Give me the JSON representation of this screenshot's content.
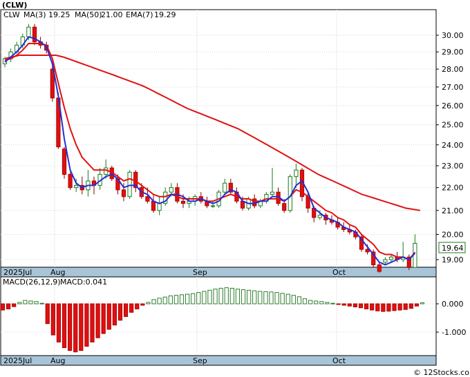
{
  "title": "(CLW)",
  "legend": {
    "ticker": "CLW",
    "ma3_label": "MA(3)",
    "ma3_value": "19.25",
    "ma50_label": "MA(50)",
    "ma50_value": "21.00",
    "ema7_label": "EMA(7)",
    "ema7_value": "19.29"
  },
  "last_price_badge": "19.64",
  "macd_legend": {
    "label": "MACD(26,12,9)",
    "value_label": "MACD:0.041"
  },
  "x_tick_labels_price": [
    "2025Jul",
    "Aug",
    "Sep",
    "Oct"
  ],
  "x_tick_labels_macd": [
    "2025Jul",
    "Aug",
    "Sep",
    "Oct"
  ],
  "watermark": "© 12Stocks.com",
  "colors": {
    "up": "#1a7a1a",
    "down": "#e01010",
    "ma3": "#1f2fd6",
    "ema7": "#e01010",
    "ma50": "#e01010",
    "macd_pos": "#2e7d2e",
    "macd_neg": "#e01010",
    "axis_band": "#a8c4d8"
  },
  "chart_data": [
    {
      "type": "candlestick",
      "title": "(CLW)",
      "ylim": [
        18.5,
        31.0
      ],
      "y_scale": "log",
      "y_ticks": [
        "19.00",
        "20.00",
        "21.00",
        "22.00",
        "23.00",
        "24.00",
        "25.00",
        "26.00",
        "27.00",
        "28.00",
        "29.00",
        "30.00"
      ],
      "x_labels": [
        "2025Jul",
        "Aug",
        "Sep",
        "Oct"
      ],
      "candles": [
        [
          28.3,
          28.7,
          28.1,
          28.6
        ],
        [
          28.6,
          29.2,
          28.4,
          29.0
        ],
        [
          29.0,
          29.6,
          28.9,
          29.4
        ],
        [
          29.4,
          30.1,
          29.2,
          29.9
        ],
        [
          29.9,
          30.7,
          29.7,
          30.5
        ],
        [
          30.5,
          30.7,
          29.4,
          29.6
        ],
        [
          29.6,
          29.9,
          29.2,
          29.4
        ],
        [
          29.4,
          29.6,
          28.9,
          29.1
        ],
        [
          28.0,
          28.2,
          26.2,
          26.4
        ],
        [
          26.4,
          26.7,
          23.8,
          23.9
        ],
        [
          23.8,
          23.9,
          22.4,
          22.6
        ],
        [
          22.6,
          22.7,
          21.9,
          22.0
        ],
        [
          22.0,
          22.4,
          21.8,
          22.1
        ],
        [
          22.1,
          22.5,
          21.7,
          21.9
        ],
        [
          21.9,
          22.8,
          21.6,
          22.3
        ],
        [
          22.3,
          22.5,
          21.7,
          22.1
        ],
        [
          22.1,
          22.9,
          21.9,
          22.6
        ],
        [
          22.6,
          23.3,
          22.4,
          22.9
        ],
        [
          22.9,
          23.0,
          22.3,
          22.4
        ],
        [
          22.4,
          22.6,
          21.7,
          21.9
        ],
        [
          21.9,
          22.2,
          21.4,
          21.6
        ],
        [
          21.6,
          22.8,
          21.5,
          22.7
        ],
        [
          22.7,
          22.8,
          21.8,
          22.0
        ],
        [
          22.0,
          22.2,
          21.5,
          21.6
        ],
        [
          21.6,
          22.0,
          21.3,
          21.4
        ],
        [
          21.4,
          21.7,
          20.9,
          21.0
        ],
        [
          21.0,
          21.6,
          20.8,
          21.3
        ],
        [
          21.3,
          22.0,
          21.2,
          21.8
        ],
        [
          21.8,
          22.2,
          21.6,
          22.0
        ],
        [
          22.0,
          22.2,
          21.3,
          21.4
        ],
        [
          21.4,
          21.7,
          21.1,
          21.3
        ],
        [
          21.3,
          21.6,
          21.1,
          21.4
        ],
        [
          21.4,
          21.7,
          21.2,
          21.6
        ],
        [
          21.6,
          21.8,
          21.3,
          21.4
        ],
        [
          21.4,
          21.6,
          21.1,
          21.2
        ],
        [
          21.2,
          21.4,
          21.1,
          21.2
        ],
        [
          21.2,
          21.9,
          21.1,
          21.8
        ],
        [
          21.8,
          22.4,
          21.7,
          22.2
        ],
        [
          22.2,
          22.4,
          21.7,
          21.8
        ],
        [
          21.8,
          22.0,
          21.3,
          21.4
        ],
        [
          21.4,
          21.6,
          21.0,
          21.1
        ],
        [
          21.1,
          21.6,
          21.0,
          21.5
        ],
        [
          21.5,
          21.7,
          21.1,
          21.2
        ],
        [
          21.2,
          21.5,
          21.1,
          21.4
        ],
        [
          21.4,
          21.8,
          21.3,
          21.7
        ],
        [
          21.7,
          22.9,
          21.6,
          21.8
        ],
        [
          21.8,
          22.0,
          21.2,
          21.3
        ],
        [
          21.3,
          21.5,
          20.9,
          21.0
        ],
        [
          21.0,
          22.6,
          20.9,
          22.5
        ],
        [
          22.5,
          23.1,
          22.0,
          22.8
        ],
        [
          22.8,
          22.9,
          21.4,
          21.6
        ],
        [
          21.6,
          21.8,
          20.9,
          21.1
        ],
        [
          21.1,
          21.2,
          20.5,
          20.7
        ],
        [
          20.7,
          21.0,
          20.6,
          20.8
        ],
        [
          20.8,
          20.9,
          20.4,
          20.6
        ],
        [
          20.6,
          20.8,
          20.4,
          20.5
        ],
        [
          20.5,
          20.7,
          20.2,
          20.3
        ],
        [
          20.3,
          20.5,
          20.1,
          20.2
        ],
        [
          20.2,
          20.4,
          20.0,
          20.1
        ],
        [
          20.1,
          20.2,
          19.8,
          19.9
        ],
        [
          19.9,
          20.0,
          19.3,
          19.4
        ],
        [
          19.4,
          19.6,
          19.2,
          19.3
        ],
        [
          19.3,
          19.4,
          18.7,
          18.8
        ],
        [
          18.8,
          18.9,
          18.5,
          18.55
        ],
        [
          18.9,
          19.1,
          18.8,
          19.0
        ],
        [
          19.0,
          19.2,
          18.9,
          19.1
        ],
        [
          19.1,
          19.3,
          18.9,
          19.0
        ],
        [
          19.0,
          19.7,
          18.9,
          19.1
        ],
        [
          19.1,
          19.2,
          18.6,
          18.7
        ],
        [
          18.7,
          20.0,
          18.8,
          19.64
        ]
      ],
      "ma3": [
        28.4,
        28.7,
        29.0,
        29.4,
        29.9,
        29.8,
        29.6,
        29.3,
        28.3,
        26.5,
        24.3,
        22.8,
        22.2,
        22.0,
        22.1,
        22.1,
        22.3,
        22.5,
        22.6,
        22.4,
        22.0,
        22.1,
        22.1,
        21.8,
        21.7,
        21.4,
        21.3,
        21.4,
        21.7,
        21.7,
        21.6,
        21.4,
        21.4,
        21.5,
        21.4,
        21.3,
        21.4,
        21.7,
        21.9,
        21.8,
        21.4,
        21.3,
        21.3,
        21.4,
        21.4,
        21.6,
        21.6,
        21.4,
        21.6,
        22.1,
        22.3,
        21.8,
        21.1,
        20.9,
        20.7,
        20.6,
        20.5,
        20.3,
        20.2,
        20.1,
        19.8,
        19.5,
        19.2,
        18.9,
        18.8,
        18.9,
        19.0,
        19.1,
        19.0,
        19.25
      ],
      "ema7": [
        28.5,
        28.6,
        28.8,
        29.1,
        29.5,
        29.5,
        29.5,
        29.4,
        28.6,
        27.2,
        25.9,
        24.8,
        24.0,
        23.4,
        23.1,
        22.8,
        22.8,
        22.8,
        22.7,
        22.5,
        22.3,
        22.4,
        22.3,
        22.1,
        21.9,
        21.7,
        21.6,
        21.6,
        21.7,
        21.6,
        21.5,
        21.5,
        21.5,
        21.5,
        21.4,
        21.4,
        21.5,
        21.6,
        21.7,
        21.6,
        21.5,
        21.5,
        21.4,
        21.4,
        21.5,
        21.5,
        21.5,
        21.4,
        21.6,
        21.9,
        21.8,
        21.6,
        21.4,
        21.2,
        21.0,
        20.9,
        20.7,
        20.6,
        20.4,
        20.3,
        20.0,
        19.8,
        19.6,
        19.3,
        19.2,
        19.2,
        19.1,
        19.1,
        19.0,
        19.29
      ],
      "ma50": [
        28.6,
        28.7,
        28.8,
        28.8,
        28.8,
        28.8,
        28.8,
        28.8,
        28.7,
        28.55,
        28.4,
        28.25,
        28.1,
        27.95,
        27.8,
        27.65,
        27.5,
        27.35,
        27.2,
        27.05,
        26.85,
        26.65,
        26.45,
        26.25,
        26.05,
        25.85,
        25.7,
        25.55,
        25.4,
        25.25,
        25.1,
        24.95,
        24.8,
        24.6,
        24.4,
        24.2,
        24.0,
        23.8,
        23.6,
        23.4,
        23.2,
        23.0,
        22.8,
        22.6,
        22.45,
        22.3,
        22.15,
        22.0,
        21.85,
        21.7,
        21.6,
        21.5,
        21.4,
        21.3,
        21.2,
        21.1,
        21.05,
        21.0
      ],
      "last_price": 19.64
    },
    {
      "type": "bar",
      "title": "MACD(26,12,9)",
      "ylim": [
        -1.8,
        0.85
      ],
      "y_ticks": [
        "0.000",
        "-1.000"
      ],
      "x_labels": [
        "2025Jul",
        "Aug",
        "Sep",
        "Oct"
      ],
      "values": [
        -0.22,
        -0.18,
        -0.1,
        0.05,
        0.12,
        0.1,
        0.08,
        0.02,
        -0.7,
        -1.1,
        -1.35,
        -1.55,
        -1.65,
        -1.7,
        -1.65,
        -1.5,
        -1.35,
        -1.2,
        -1.05,
        -0.9,
        -0.75,
        -0.58,
        -0.45,
        -0.3,
        -0.18,
        -0.05,
        0.05,
        0.15,
        0.2,
        0.24,
        0.28,
        0.3,
        0.32,
        0.34,
        0.36,
        0.4,
        0.44,
        0.48,
        0.52,
        0.55,
        0.57,
        0.55,
        0.52,
        0.5,
        0.48,
        0.46,
        0.44,
        0.43,
        0.42,
        0.4,
        0.37,
        0.34,
        0.3,
        0.25,
        0.18,
        0.12,
        0.1,
        0.08,
        0.05,
        0.02,
        -0.02,
        -0.05,
        -0.08,
        -0.11,
        -0.14,
        -0.18,
        -0.22,
        -0.25,
        -0.27,
        -0.26,
        -0.24,
        -0.22,
        -0.2,
        -0.16,
        -0.08,
        0.041
      ],
      "last_value": 0.041
    }
  ]
}
